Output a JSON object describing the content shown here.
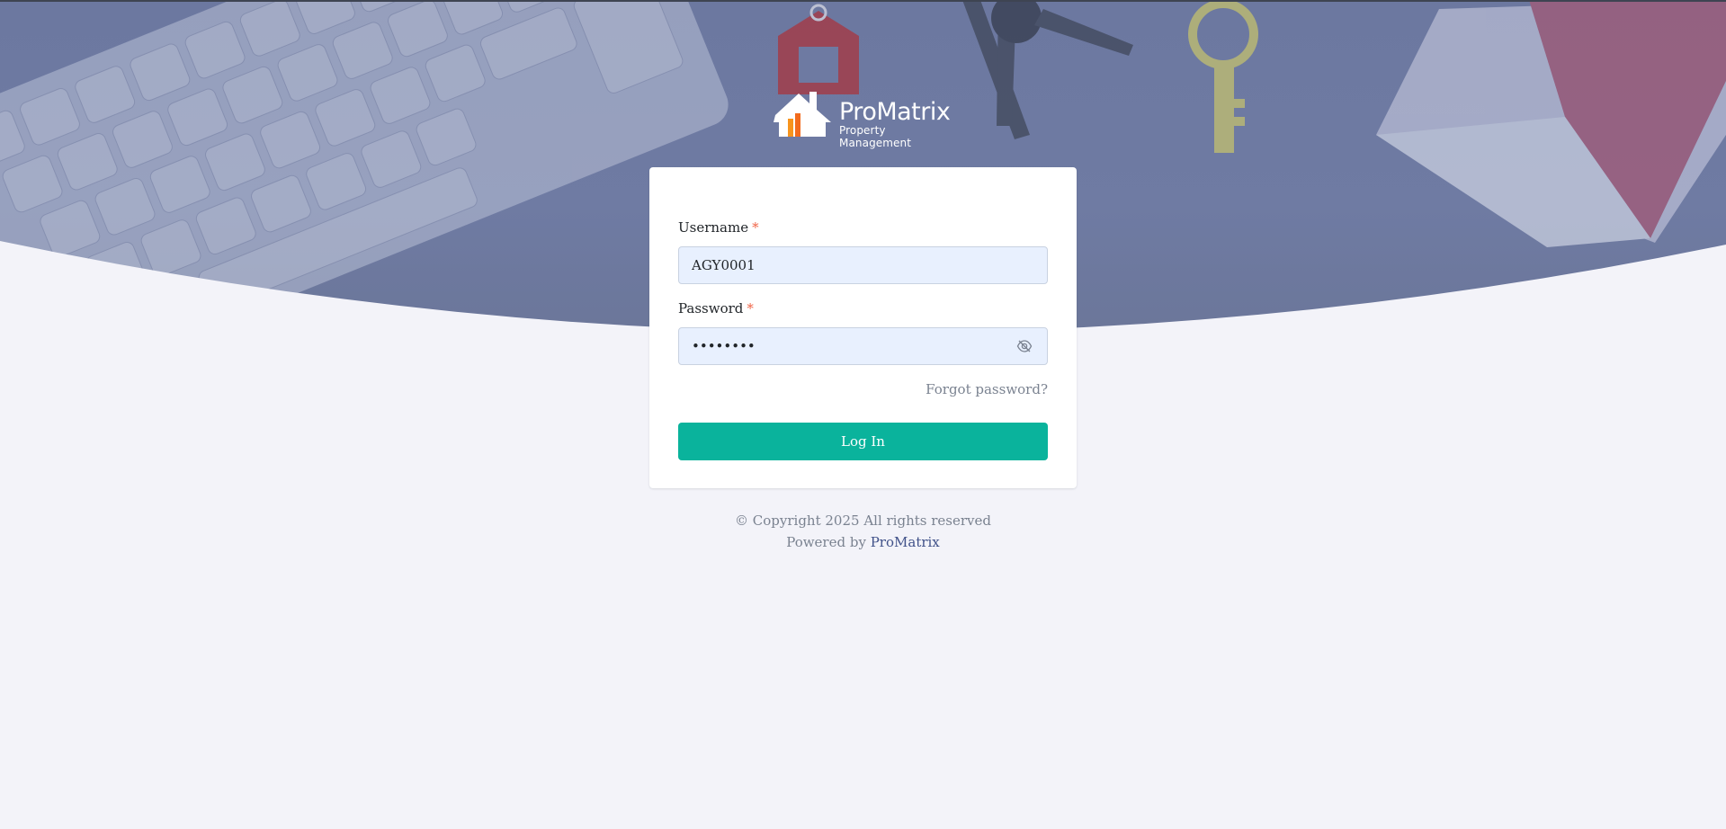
{
  "brand": {
    "name": "ProMatrix",
    "tagline": "Property Management"
  },
  "form": {
    "username_label": "Username",
    "username_value": "AGY0001",
    "password_label": "Password",
    "password_value": "••••••••",
    "required_mark": "*",
    "forgot_label": "Forgot password?",
    "login_label": "Log In"
  },
  "footer": {
    "copyright": "© Copyright 2025 All rights reserved",
    "powered_prefix": "Powered by",
    "powered_brand": "ProMatrix"
  },
  "colors": {
    "accent": "#0ab39c",
    "brand_link": "#405189",
    "required": "#f06548",
    "hero": "#6f7ba3",
    "background": "#f3f3f9"
  },
  "icons": {
    "password_toggle": "eye-off-icon"
  }
}
